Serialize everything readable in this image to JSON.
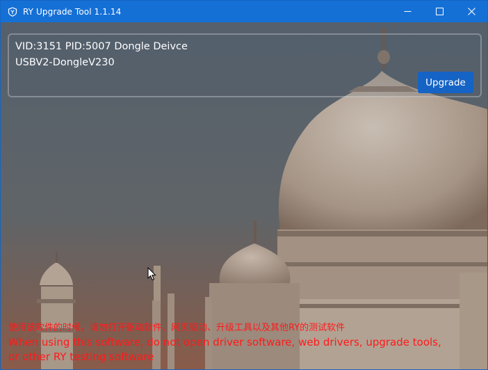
{
  "window": {
    "title": "RY Upgrade Tool 1.1.14",
    "controls": [
      "minimize",
      "maximize",
      "close"
    ]
  },
  "device": {
    "line1": "VID:3151 PID:5007 Dongle Deivce",
    "line2": "USBV2-DongleV230"
  },
  "actions": {
    "upgrade_label": "Upgrade"
  },
  "warning": {
    "zh": "使用该软件的时候，请勿打开驱动软件、网页驱动、升级工具以及其他RY的测试软件",
    "en_line1": "When using this software, do not open driver software, web drivers, upgrade tools,",
    "en_line2": "or other RY testing software"
  },
  "colors": {
    "titlebar": "#1570d6",
    "button": "#1563c4",
    "warning_text": "#ff1a1a"
  },
  "icons": {
    "app": "shield-y-icon",
    "minimize": "minimize-icon",
    "maximize": "maximize-icon",
    "close": "close-icon"
  }
}
